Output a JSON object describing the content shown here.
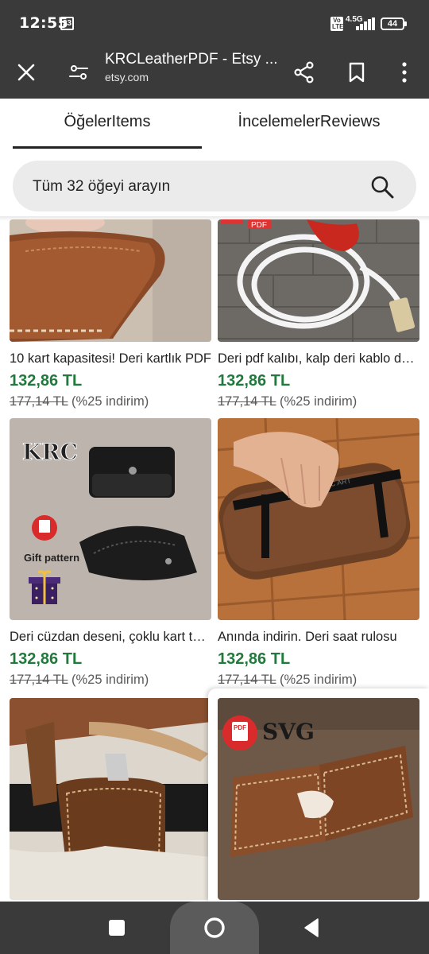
{
  "status": {
    "time": "12:55",
    "notification_badge": "23",
    "volte": "Vo LTE",
    "network": "4.5G",
    "battery": "44"
  },
  "browser": {
    "title": "KRCLeatherPDF - Etsy ...",
    "domain": "etsy.com"
  },
  "tabs": {
    "items": "ÖğelerItems",
    "reviews": "İncelemelerReviews",
    "active": "items"
  },
  "search": {
    "placeholder": "Tüm 32 öğeyi arayın"
  },
  "products": [
    {
      "title": "10 kart kapasitesi! Deri kartlık PDF",
      "price": "132,86 TL",
      "old_price": "177,14 TL",
      "discount": "(%25 indirim)"
    },
    {
      "title": "Deri pdf kalıbı, kalp deri kablo düzenleyici",
      "price": "132,86 TL",
      "old_price": "177,14 TL",
      "discount": "(%25 indirim)"
    },
    {
      "title": "Deri cüzdan deseni, çoklu kart tutucu",
      "price": "132,86 TL",
      "old_price": "177,14 TL",
      "discount": "(%25 indirim)",
      "image_text": {
        "logo": "KRC",
        "gift_label": "Gift pattern"
      }
    },
    {
      "title": "Anında indirin. Deri saat rulosu",
      "price": "132,86 TL",
      "old_price": "177,14 TL",
      "discount": "(%25 indirim)",
      "image_text": {
        "strap": "KRC ART"
      }
    },
    {
      "title": "",
      "price": "",
      "old_price": "",
      "discount": ""
    },
    {
      "title": "",
      "price": "",
      "old_price": "",
      "discount": "",
      "image_text": {
        "badge": "PDF",
        "format": "SVG"
      }
    }
  ],
  "colors": {
    "bar": "#3a3a3a",
    "price_green": "#217a3c",
    "search_bg": "#ebebeb"
  },
  "icons": [
    "close-icon",
    "page-settings-icon",
    "share-icon",
    "bookmark-icon",
    "more-vertical-icon",
    "search-icon",
    "square-icon",
    "home-circle-icon",
    "back-triangle-icon"
  ]
}
